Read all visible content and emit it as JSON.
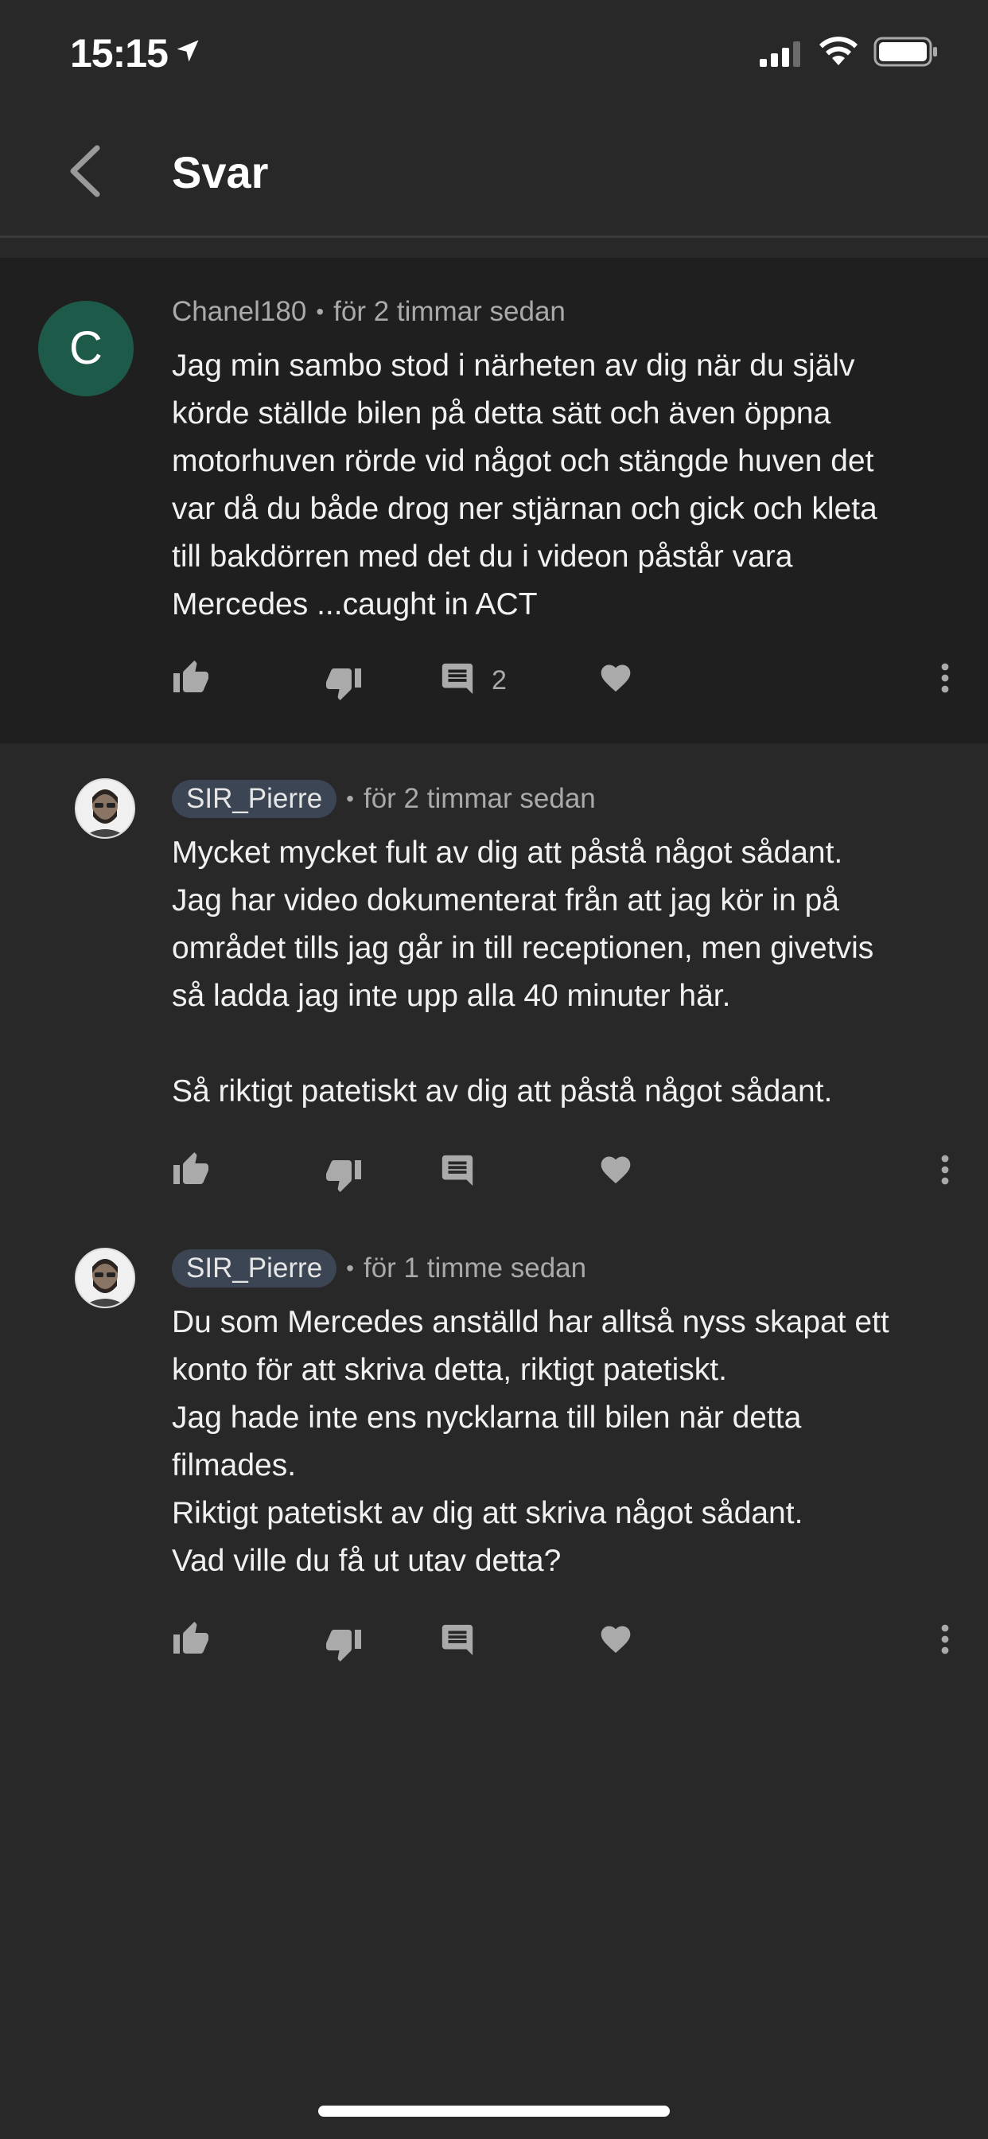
{
  "status_bar": {
    "time": "15:15"
  },
  "header": {
    "title": "Svar"
  },
  "parent_comment": {
    "avatar_letter": "C",
    "username": "Chanel180",
    "separator": "•",
    "timestamp": "för 2 timmar sedan",
    "text": "Jag min sambo stod i närheten av dig när du själv\nkörde ställde bilen på detta sätt och även öppna\nmotorhuven rörde vid något och stängde huven det\nvar då du både drog ner stjärnan och gick och kleta\ntill bakdörren med det du i videon påstår vara\nMercedes ...caught in ACT",
    "reply_count": "2"
  },
  "replies": [
    {
      "username": "SIR_Pierre",
      "separator": "•",
      "timestamp": "för 2 timmar sedan",
      "text": "Mycket mycket fult av dig att påstå något sådant.\nJag har video dokumenterat från att jag kör in på\nområdet tills jag går in till receptionen, men givetvis\nså ladda jag inte upp alla 40 minuter här.\n\nSå riktigt patetiskt av dig att påstå något sådant."
    },
    {
      "username": "SIR_Pierre",
      "separator": "•",
      "timestamp": "för 1 timme sedan",
      "text": "Du som Mercedes anställd har alltså nyss skapat ett\nkonto för att skriva detta, riktigt patetiskt.\nJag hade inte ens nycklarna till bilen när detta\nfilmades.\nRiktigt patetiskt av dig att skriva något sådant.\nVad ville du få ut utav detta?"
    }
  ],
  "colors": {
    "background": "#282828",
    "parent_background": "#1f1f1f",
    "avatar_green": "#1e5a4a",
    "pill": "#3c4553",
    "icon_gray": "#aaaaaa"
  }
}
